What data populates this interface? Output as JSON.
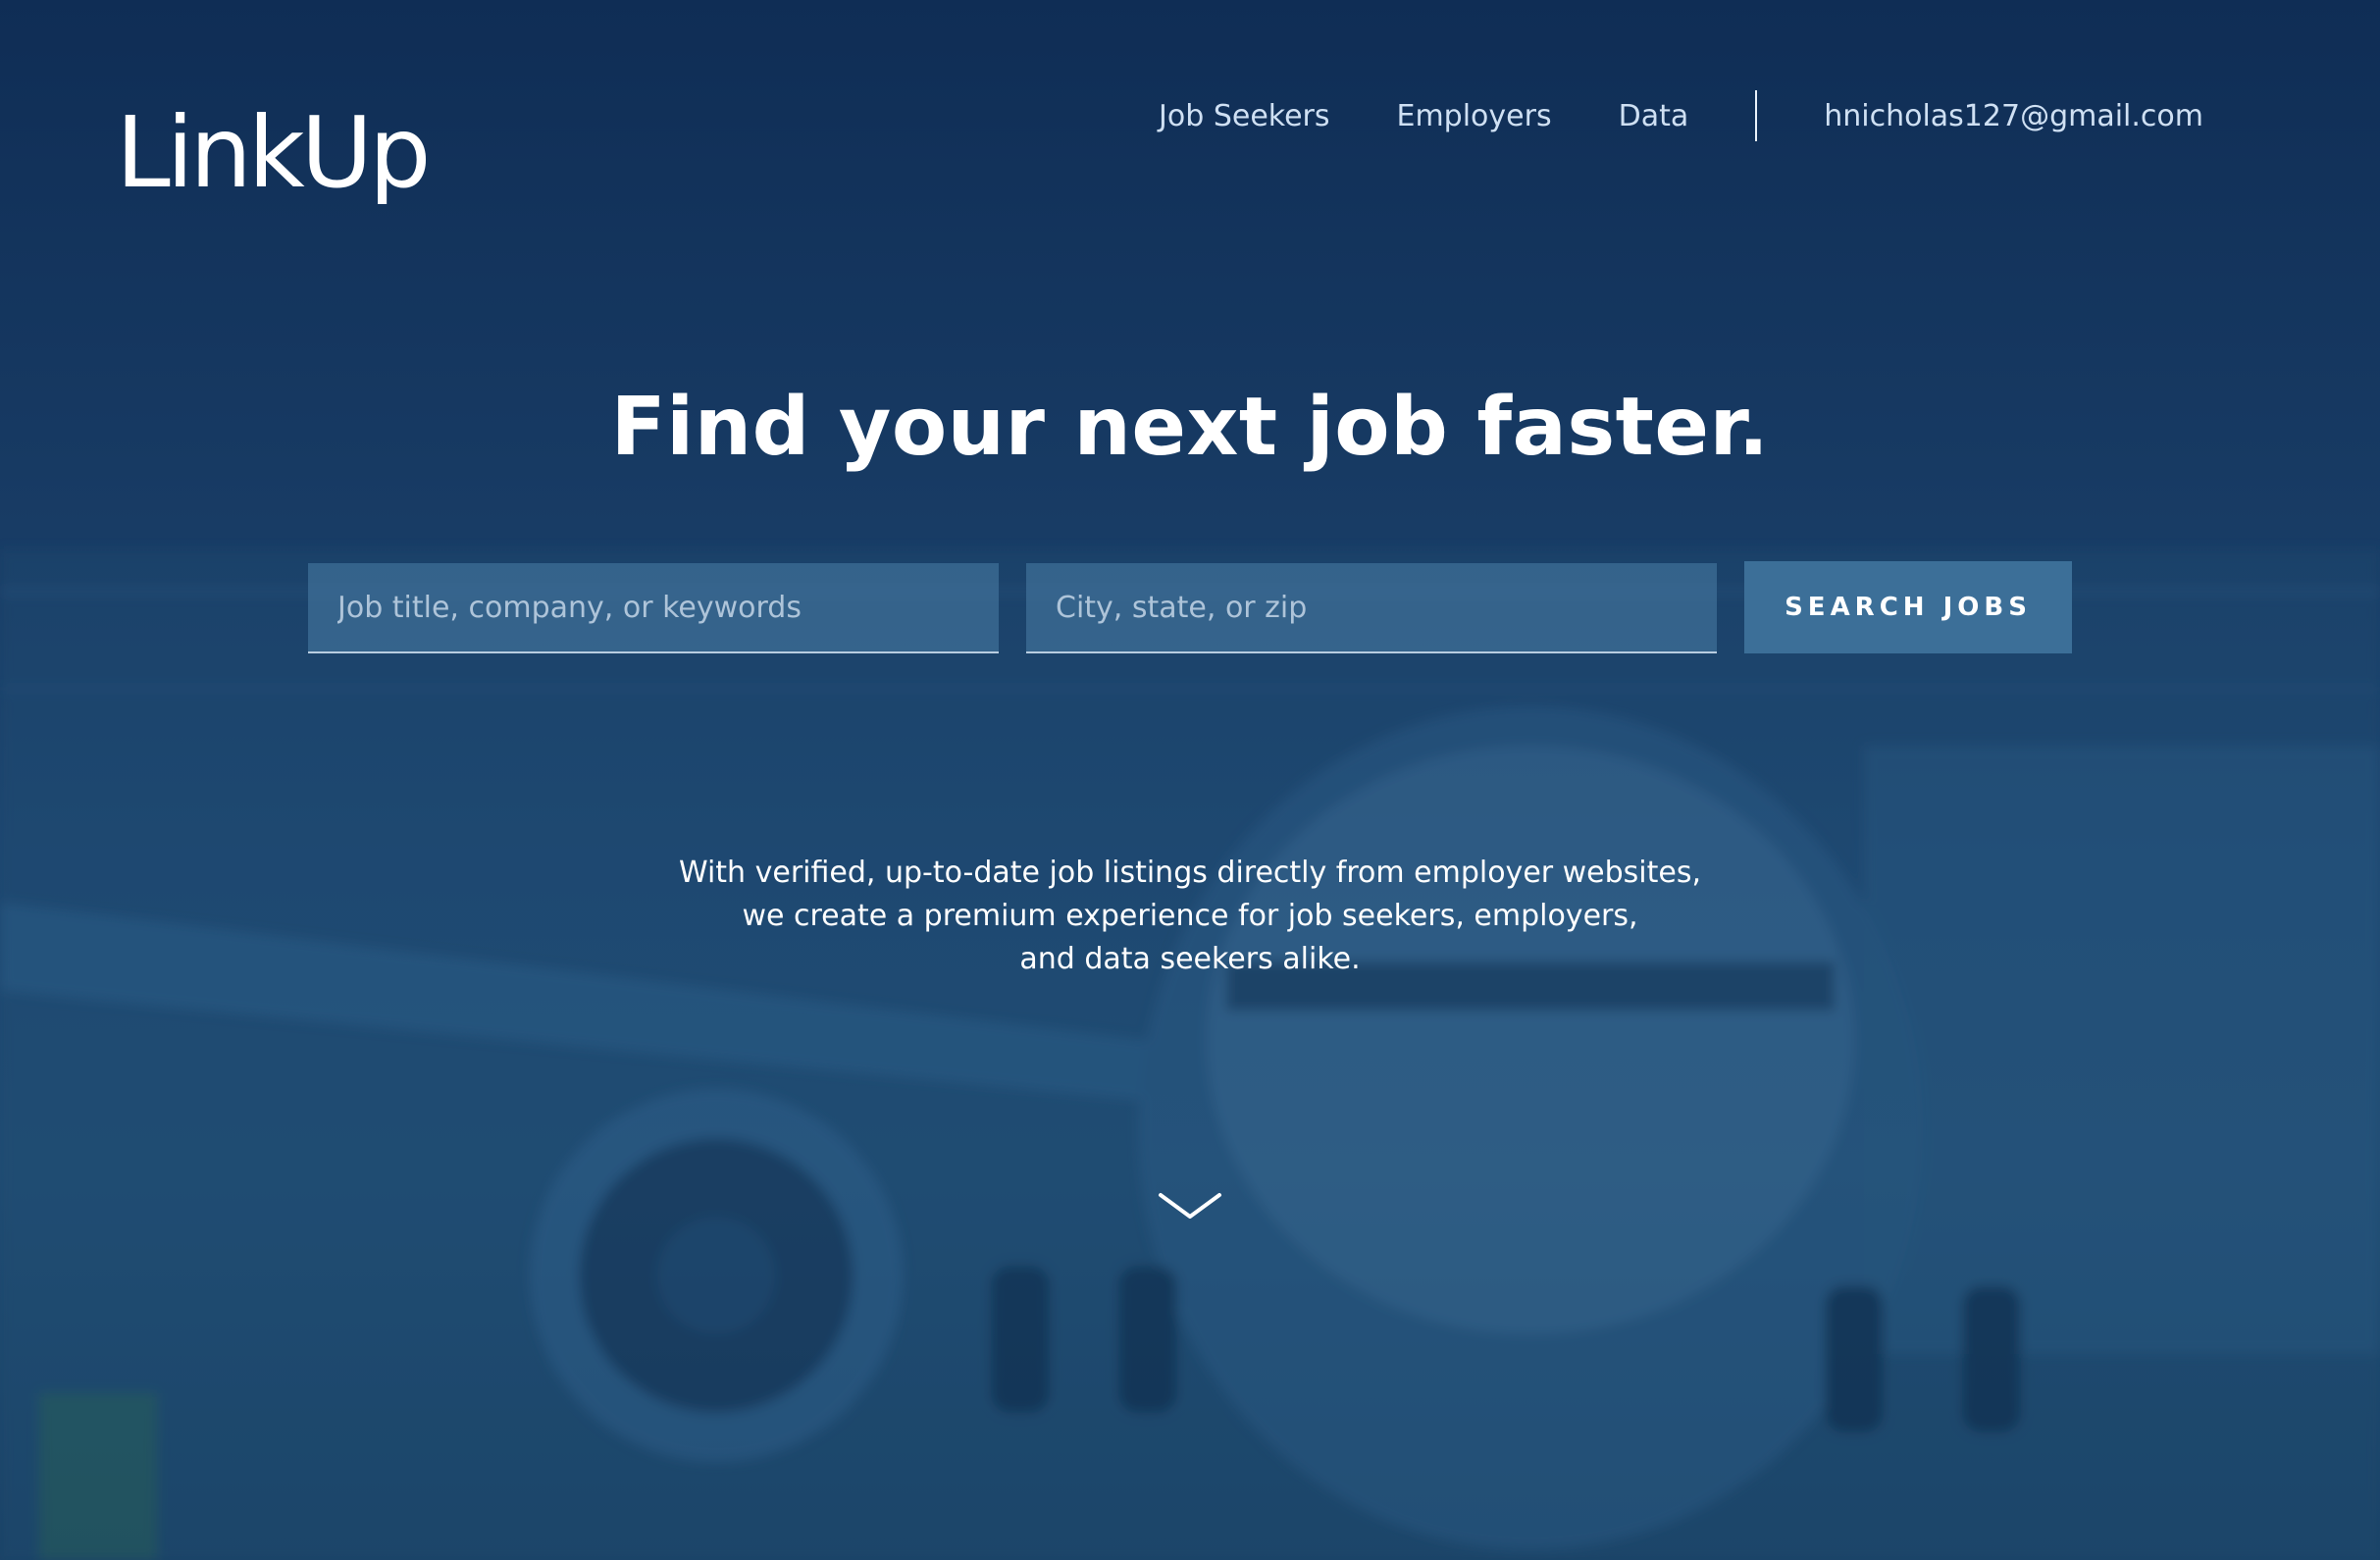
{
  "brand": {
    "logo_text": "LinkUp"
  },
  "nav": {
    "items": [
      {
        "label": "Job Seekers"
      },
      {
        "label": "Employers"
      },
      {
        "label": "Data"
      }
    ],
    "user_email": "hnicholas127@gmail.com"
  },
  "hero": {
    "headline": "Find your next job faster.",
    "search": {
      "keywords_placeholder": "Job title, company, or keywords",
      "location_placeholder": "City, state, or zip",
      "button_label": "SEARCH JOBS"
    },
    "tagline_lines": [
      "With verified, up-to-date job listings directly from employer websites,",
      "we create a premium experience for job seekers, employers,",
      "and data seekers alike."
    ],
    "scroll_icon": "chevron-down-icon"
  },
  "colors": {
    "background": "#173a63",
    "button": "#3c6f98",
    "nav_text": "#cfe0f3",
    "headline_text": "#ffffff"
  }
}
